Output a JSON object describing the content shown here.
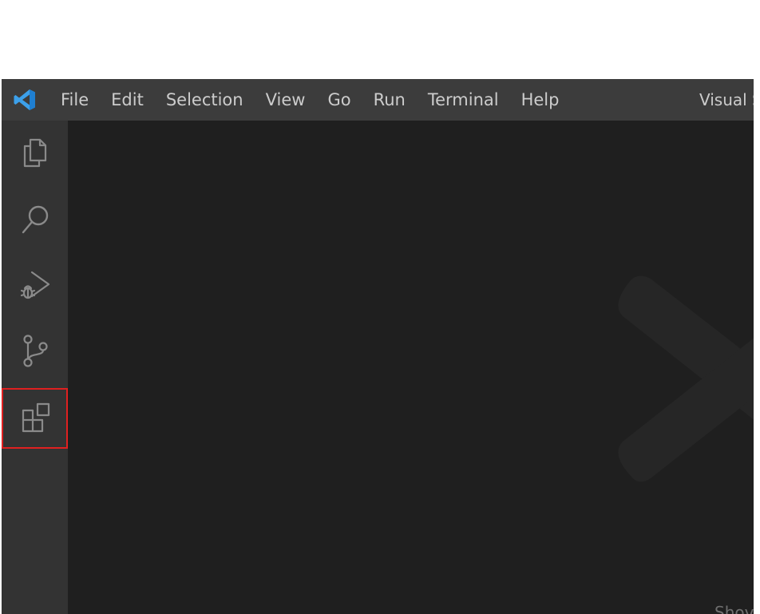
{
  "titlebar": {
    "menu": [
      "File",
      "Edit",
      "Selection",
      "View",
      "Go",
      "Run",
      "Terminal",
      "Help"
    ],
    "window_title": "Visual S"
  },
  "activitybar": {
    "items": [
      {
        "name": "explorer",
        "icon": "files-icon"
      },
      {
        "name": "search",
        "icon": "search-icon"
      },
      {
        "name": "run-and-debug",
        "icon": "debug-icon"
      },
      {
        "name": "source-control",
        "icon": "source-control-icon"
      },
      {
        "name": "extensions",
        "icon": "extensions-icon",
        "highlighted": true
      }
    ]
  },
  "editor": {
    "partial_text": "Shov"
  },
  "colors": {
    "titlebar_bg": "#3c3c3c",
    "activitybar_bg": "#333333",
    "editor_bg": "#1f1f1f",
    "icon_color": "#8a8a8a",
    "logo_blue": "#3ca0ea",
    "highlight": "#e02020"
  }
}
